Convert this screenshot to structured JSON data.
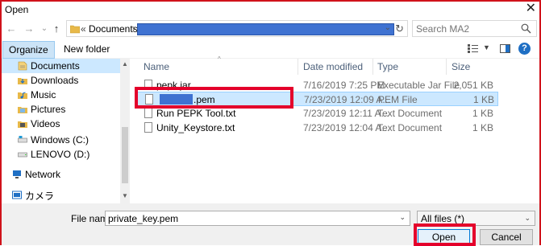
{
  "window": {
    "title": "Open",
    "close_glyph": "✕"
  },
  "nav": {
    "back_glyph": "←",
    "forward_glyph": "→",
    "recent_glyph": "⌄",
    "up_glyph": "↑",
    "path_prefix": "«",
    "path_root": "Documents",
    "path_arrow": "›",
    "dropdown_glyph": "⌄",
    "refresh_glyph": "↻",
    "search_placeholder": "Search MA2"
  },
  "toolbar": {
    "organize_label": "Organize ▾",
    "new_folder_label": "New folder",
    "view_dd_glyph": "▼",
    "help_label": "?"
  },
  "sidebar": {
    "items": [
      {
        "label": "Documents",
        "icon": "documents-icon",
        "selected": true
      },
      {
        "label": "Downloads",
        "icon": "downloads-icon"
      },
      {
        "label": "Music",
        "icon": "music-icon"
      },
      {
        "label": "Pictures",
        "icon": "pictures-icon"
      },
      {
        "label": "Videos",
        "icon": "videos-icon"
      },
      {
        "label": "Windows (C:)",
        "icon": "drive-icon"
      },
      {
        "label": "LENOVO (D:)",
        "icon": "drive-icon"
      },
      {
        "label": "Network",
        "icon": "network-icon"
      },
      {
        "label": "カメラ",
        "icon": "camera-icon"
      }
    ],
    "scroll_up": "▲",
    "scroll_down": "▼"
  },
  "files": {
    "columns": {
      "name": "Name",
      "date": "Date modified",
      "type": "Type",
      "size": "Size",
      "sort_glyph": "^"
    },
    "rows": [
      {
        "name": "pepk.jar",
        "date": "7/16/2019 7:25 PM",
        "type": "Executable Jar File",
        "size": "2,051 KB"
      },
      {
        "name": ".pem",
        "date": "7/23/2019 12:09 A...",
        "type": "PEM File",
        "size": "1 KB",
        "selected": true
      },
      {
        "name": "Run PEPK Tool.txt",
        "date": "7/23/2019 12:11 A...",
        "type": "Text Document",
        "size": "1 KB"
      },
      {
        "name": "Unity_Keystore.txt",
        "date": "7/23/2019 12:04 A...",
        "type": "Text Document",
        "size": "1 KB"
      }
    ]
  },
  "footer": {
    "file_name_label": "File name:",
    "file_name_value": "private_key.pem",
    "dropdown_glyph": "⌄",
    "filter_value": "All files (*)",
    "open_label": "Open",
    "cancel_label": "Cancel"
  },
  "colors": {
    "accent": "#0078d7",
    "highlight": "#e4002b",
    "selection": "#cce8ff",
    "redaction": "#3f72d1"
  }
}
